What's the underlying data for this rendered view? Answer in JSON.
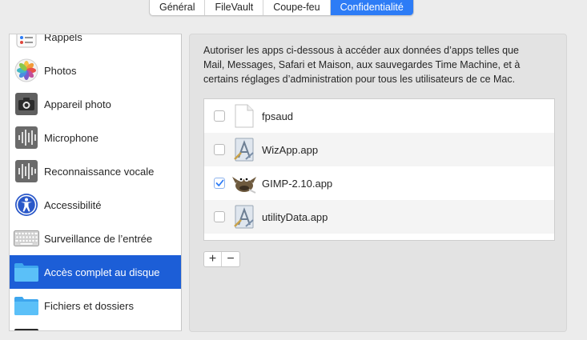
{
  "tabs": [
    {
      "label": "Général",
      "active": false
    },
    {
      "label": "FileVault",
      "active": false
    },
    {
      "label": "Coupe-feu",
      "active": false
    },
    {
      "label": "Confidentialité",
      "active": true
    }
  ],
  "sidebar": {
    "items": [
      {
        "label": "Rappels",
        "icon": "reminders-icon"
      },
      {
        "label": "Photos",
        "icon": "photos-icon"
      },
      {
        "label": "Appareil photo",
        "icon": "camera-icon"
      },
      {
        "label": "Microphone",
        "icon": "microphone-icon"
      },
      {
        "label": "Reconnaissance vocale",
        "icon": "speech-recognition-icon"
      },
      {
        "label": "Accessibilité",
        "icon": "accessibility-icon"
      },
      {
        "label": "Surveillance de l’entrée",
        "icon": "keyboard-icon"
      },
      {
        "label": "Accès complet au disque",
        "icon": "folder-icon",
        "selected": true
      },
      {
        "label": "Fichiers et dossiers",
        "icon": "folder-icon"
      }
    ]
  },
  "main": {
    "description_lines": [
      "Autoriser les apps ci-dessous à accéder aux données d’apps telles que",
      "Mail, Messages, Safari et Maison, aux sauvegardes Time Machine, et à",
      "certains réglages d’administration pour tous les utilisateurs de ce Mac."
    ],
    "apps": [
      {
        "name": "fpsaud",
        "checked": false,
        "icon": "generic-file-icon"
      },
      {
        "name": "WizApp.app",
        "checked": false,
        "icon": "generic-app-icon"
      },
      {
        "name": "GIMP-2.10.app",
        "checked": true,
        "icon": "gimp-icon"
      },
      {
        "name": "utilityData.app",
        "checked": false,
        "icon": "generic-app-icon"
      }
    ],
    "add_label": "+",
    "remove_label": "−"
  },
  "colors": {
    "accent": "#2d7cf6",
    "selection": "#1c5ed7",
    "folder": "#4ab6f5"
  }
}
